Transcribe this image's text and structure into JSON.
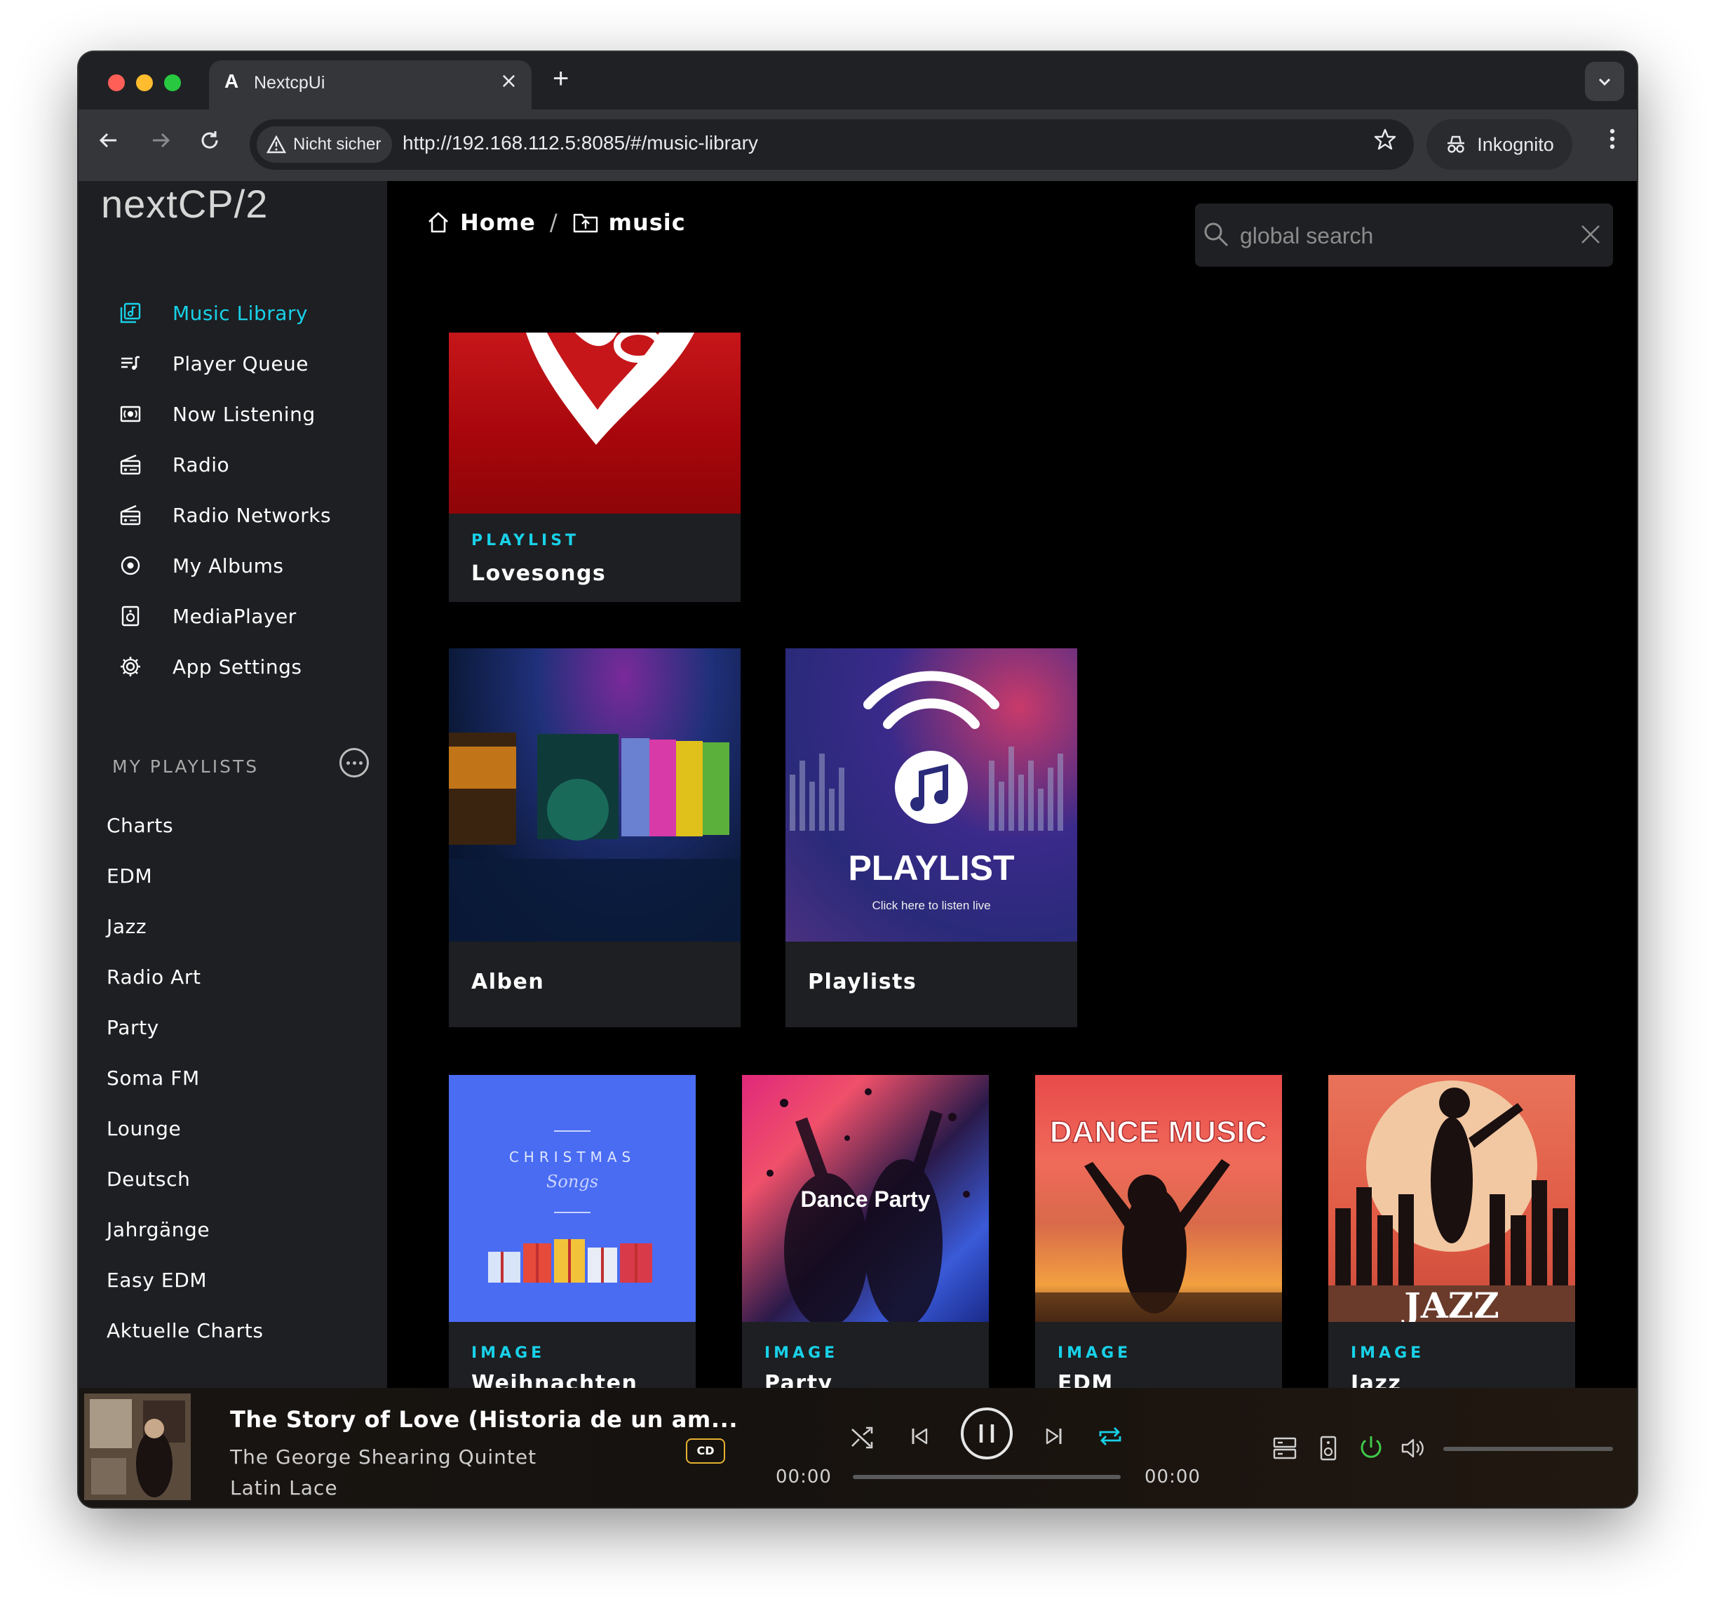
{
  "browser": {
    "tab_title": "NextcpUi",
    "tab_logo": "A",
    "security_label": "Nicht sicher",
    "url": "http://192.168.112.5:8085/#/music-library",
    "incognito_label": "Inkognito"
  },
  "app": {
    "brand": "nextCP/2",
    "accent_color": "#18d1e8",
    "nav": [
      {
        "label": "Music Library",
        "icon": "library-music-icon",
        "active": true
      },
      {
        "label": "Player Queue",
        "icon": "queue-icon"
      },
      {
        "label": "Now Listening",
        "icon": "now-listening-icon"
      },
      {
        "label": "Radio",
        "icon": "radio-icon"
      },
      {
        "label": "Radio Networks",
        "icon": "radio-networks-icon"
      },
      {
        "label": "My Albums",
        "icon": "album-icon"
      },
      {
        "label": "MediaPlayer",
        "icon": "media-player-icon"
      },
      {
        "label": "App Settings",
        "icon": "gear-icon"
      }
    ],
    "playlists_header": "MY PLAYLISTS",
    "playlists": [
      "Charts",
      "EDM",
      "Jazz",
      "Radio Art",
      "Party",
      "Soma FM",
      "Lounge",
      "Deutsch",
      "Jahrgänge",
      "Easy EDM",
      "Aktuelle Charts"
    ]
  },
  "header": {
    "breadcrumb_home": "Home",
    "breadcrumb_sep": "/",
    "breadcrumb_current": "music",
    "search_placeholder": "global search"
  },
  "cards": {
    "lovesongs": {
      "type": "PLAYLIST",
      "title": "Lovesongs"
    },
    "alben": {
      "title": "Alben"
    },
    "playlists": {
      "title": "Playlists",
      "art_text": "PLAYLIST",
      "art_subtext": "Click here to listen live"
    },
    "weihnachten": {
      "type": "IMAGE",
      "title": "Weihnachten",
      "art_text": "CHRISTMAS",
      "art_subtext": "Songs"
    },
    "party": {
      "type": "IMAGE",
      "title": "Party",
      "art_text": "Dance Party"
    },
    "edm": {
      "type": "IMAGE",
      "title": "EDM",
      "art_text": "DANCE MUSIC"
    },
    "jazz": {
      "type": "IMAGE",
      "title": "Jazz",
      "art_text": "JAZZ"
    }
  },
  "player": {
    "title": "The Story of Love (Historia de un am...",
    "artist": "The George Shearing Quintet",
    "album": "Latin Lace",
    "badge": "CD",
    "time_elapsed": "00:00",
    "time_total": "00:00",
    "progress": 0,
    "power_color": "#3ec94a"
  }
}
